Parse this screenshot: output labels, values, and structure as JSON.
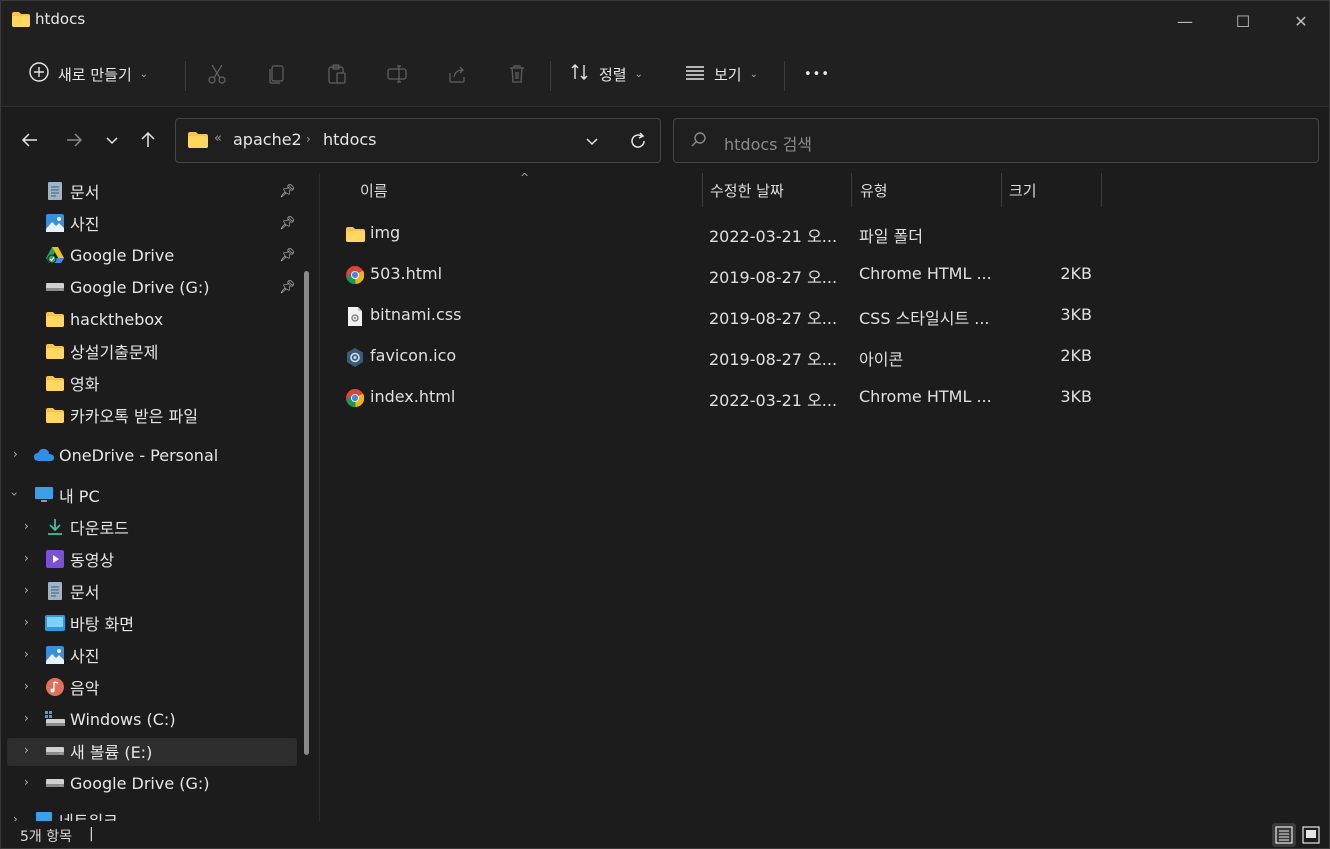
{
  "window": {
    "title": "htdocs",
    "minimize": "—",
    "maximize": "☐",
    "close": "✕"
  },
  "commandbar": {
    "new_label": "새로 만들기",
    "sort_label": "정렬",
    "view_label": "보기",
    "more": "•••"
  },
  "address": {
    "overflow": "«",
    "crumbs": [
      "apache2",
      "htdocs"
    ],
    "search_placeholder": "htdocs 검색"
  },
  "nav": {
    "quick_access": [
      {
        "label": "문서",
        "icon": "document-icon",
        "pinned": true
      },
      {
        "label": "사진",
        "icon": "pictures-icon",
        "pinned": true
      },
      {
        "label": "Google Drive",
        "icon": "google-drive-icon",
        "pinned": true
      },
      {
        "label": "Google Drive (G:)",
        "icon": "drive-icon",
        "pinned": true
      },
      {
        "label": "hackthebox",
        "icon": "folder-icon",
        "pinned": false
      },
      {
        "label": "상설기출문제",
        "icon": "folder-icon",
        "pinned": false
      },
      {
        "label": "영화",
        "icon": "folder-icon",
        "pinned": false
      },
      {
        "label": "카카오톡 받은 파일",
        "icon": "folder-icon",
        "pinned": false
      }
    ],
    "onedrive": "OneDrive - Personal",
    "this_pc": "내 PC",
    "pc_items": [
      {
        "label": "다운로드",
        "icon": "download-icon"
      },
      {
        "label": "동영상",
        "icon": "videos-icon"
      },
      {
        "label": "문서",
        "icon": "document-icon"
      },
      {
        "label": "바탕 화면",
        "icon": "desktop-icon"
      },
      {
        "label": "사진",
        "icon": "pictures-icon"
      },
      {
        "label": "음악",
        "icon": "music-icon"
      },
      {
        "label": "Windows (C:)",
        "icon": "windows-drive-icon"
      },
      {
        "label": "새 볼륨 (E:)",
        "icon": "drive-icon"
      },
      {
        "label": "Google Drive (G:)",
        "icon": "drive-icon"
      }
    ],
    "network_partial": "네트워크"
  },
  "columns": {
    "name": "이름",
    "modified": "수정한 날짜",
    "type": "유형",
    "size": "크기"
  },
  "files": [
    {
      "name": "img",
      "modified": "2022-03-21 오...",
      "type": "파일 폴더",
      "size": "",
      "icon": "folder-icon"
    },
    {
      "name": "503.html",
      "modified": "2019-08-27 오...",
      "type": "Chrome HTML ...",
      "size": "2KB",
      "icon": "chrome-icon"
    },
    {
      "name": "bitnami.css",
      "modified": "2019-08-27 오...",
      "type": "CSS 스타일시트 ...",
      "size": "3KB",
      "icon": "css-file-icon"
    },
    {
      "name": "favicon.ico",
      "modified": "2019-08-27 오...",
      "type": "아이콘",
      "size": "2KB",
      "icon": "ico-file-icon"
    },
    {
      "name": "index.html",
      "modified": "2022-03-21 오...",
      "type": "Chrome HTML ...",
      "size": "3KB",
      "icon": "chrome-icon"
    }
  ],
  "status": {
    "count": "5개 항목",
    "cursor": "|"
  },
  "colors": {
    "folder": "#f4c54a",
    "background": "#1c1c1c",
    "selected": "#2d2d2d"
  }
}
